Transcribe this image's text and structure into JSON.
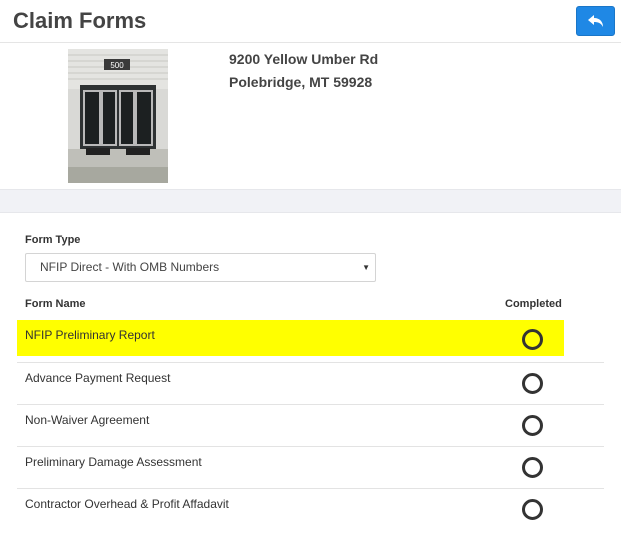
{
  "header": {
    "title": "Claim Forms",
    "back_icon": "reply-arrow-icon",
    "accent_color": "#1f88e5"
  },
  "property": {
    "photo_icon": "building-entrance-photo",
    "building_number": "500",
    "address_line1": "9200 Yellow Umber Rd",
    "address_line2": "Polebridge, MT 59928"
  },
  "form_type": {
    "label": "Form Type",
    "selected": "NFIP Direct - With OMB Numbers"
  },
  "table": {
    "col_name": "Form Name",
    "col_completed": "Completed",
    "rows": [
      {
        "name": "NFIP Preliminary Report",
        "completed": false,
        "highlighted": true
      },
      {
        "name": "Advance Payment Request",
        "completed": false
      },
      {
        "name": "Non-Waiver Agreement",
        "completed": false
      },
      {
        "name": "Preliminary Damage Assessment",
        "completed": false
      },
      {
        "name": "Contractor Overhead & Profit Affadavit",
        "completed": false
      }
    ]
  },
  "colors": {
    "highlight": "#ffff00"
  }
}
